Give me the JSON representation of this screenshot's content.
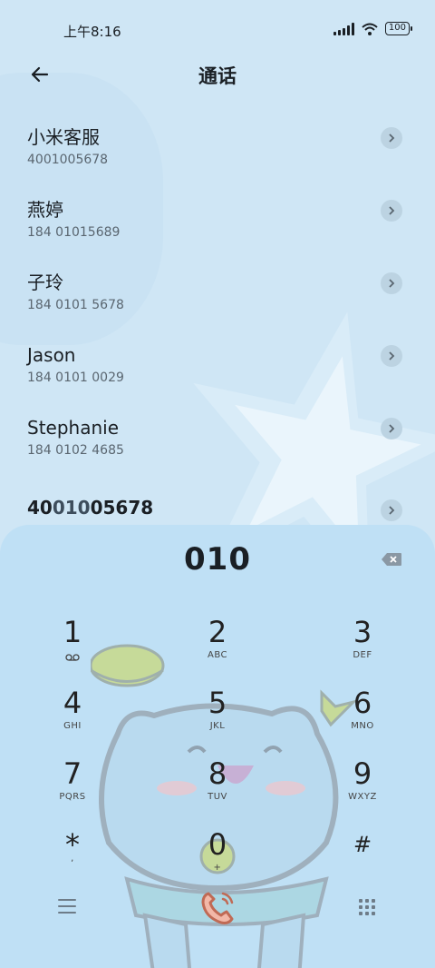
{
  "status_bar": {
    "time": "上午8:16",
    "battery": "100"
  },
  "header": {
    "title": "通话"
  },
  "contacts": [
    {
      "name": "小米客服",
      "number": "4001005678"
    },
    {
      "name": "燕婷",
      "number": "184 01015689"
    },
    {
      "name": "子玲",
      "number": "184 0101 5678"
    },
    {
      "name": "Jason",
      "number": "184 0101 0029"
    },
    {
      "name": "Stephanie",
      "number": "184 0102 4685"
    }
  ],
  "partial_match": {
    "pre": "40",
    "match": "010",
    "post": "05678"
  },
  "dialpad": {
    "input": "010",
    "keys": [
      {
        "digit": "1",
        "letters": ""
      },
      {
        "digit": "2",
        "letters": "ABC"
      },
      {
        "digit": "3",
        "letters": "DEF"
      },
      {
        "digit": "4",
        "letters": "GHI"
      },
      {
        "digit": "5",
        "letters": "JKL"
      },
      {
        "digit": "6",
        "letters": "MNO"
      },
      {
        "digit": "7",
        "letters": "PQRS"
      },
      {
        "digit": "8",
        "letters": "TUV"
      },
      {
        "digit": "9",
        "letters": "WXYZ"
      },
      {
        "digit": "*",
        "letters": ","
      },
      {
        "digit": "0",
        "letters": "+"
      },
      {
        "digit": "#",
        "letters": ""
      }
    ]
  },
  "icons": {
    "back": "back-arrow-icon",
    "chevron": "chevron-right-icon",
    "delete": "backspace-icon",
    "menu": "menu-icon",
    "call": "call-icon",
    "keypad": "keypad-icon",
    "voicemail": "voicemail-icon"
  },
  "colors": {
    "background": "#cfe6f5",
    "panel": "#bfe0f5",
    "accent": "#3d4d5c"
  }
}
